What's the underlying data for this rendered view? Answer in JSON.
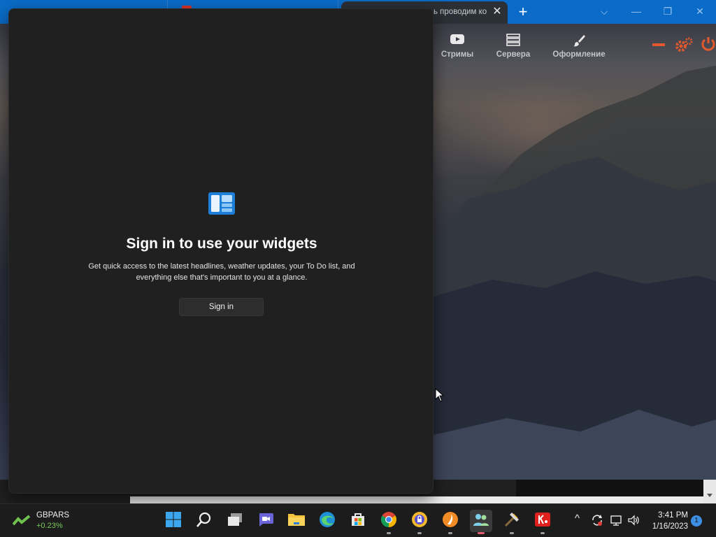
{
  "browser": {
    "active_tab_title": "ь проводим ко",
    "tab_close_glyph": "✕",
    "new_tab_glyph": "+",
    "window_controls": {
      "dropdown": "⌵",
      "minimize": "—",
      "restore": "❐",
      "close": "✕"
    }
  },
  "site": {
    "nav": [
      {
        "label": "Стримы",
        "icon": "youtube-icon"
      },
      {
        "label": "Сервера",
        "icon": "server-icon"
      },
      {
        "label": "Оформление",
        "icon": "paintbrush-icon"
      }
    ],
    "controls": [
      "minimize-icon",
      "settings-icon",
      "power-icon"
    ],
    "accent_color": "#e2592e"
  },
  "widgets": {
    "title": "Sign in to use your widgets",
    "description": "Get quick access to the latest headlines, weather updates, your To Do list, and everything else that's important to you at a glance.",
    "sign_in_label": "Sign in"
  },
  "taskbar": {
    "ticker": {
      "symbol": "GBPARS",
      "change": "+0.23%",
      "change_color": "#7ac95a"
    },
    "apps": [
      {
        "name": "start",
        "icon": "windows-start-icon"
      },
      {
        "name": "search",
        "icon": "search-icon"
      },
      {
        "name": "task-view",
        "icon": "task-view-icon"
      },
      {
        "name": "chat",
        "icon": "teams-chat-icon"
      },
      {
        "name": "file-explorer",
        "icon": "folder-icon"
      },
      {
        "name": "edge",
        "icon": "edge-icon"
      },
      {
        "name": "store",
        "icon": "microsoft-store-icon"
      },
      {
        "name": "chrome",
        "icon": "chrome-icon"
      },
      {
        "name": "vpn",
        "icon": "vpn-shield-icon"
      },
      {
        "name": "java-app",
        "icon": "java-icon"
      },
      {
        "name": "launcher",
        "icon": "people-launcher-icon"
      },
      {
        "name": "minecraft-launcher",
        "icon": "minecraft-icon"
      },
      {
        "name": "kaspersky",
        "icon": "kaspersky-icon"
      }
    ],
    "tray": {
      "overflow": "^",
      "clock_time": "3:41 PM",
      "clock_date": "1/16/2023",
      "notification_count": "1"
    }
  }
}
